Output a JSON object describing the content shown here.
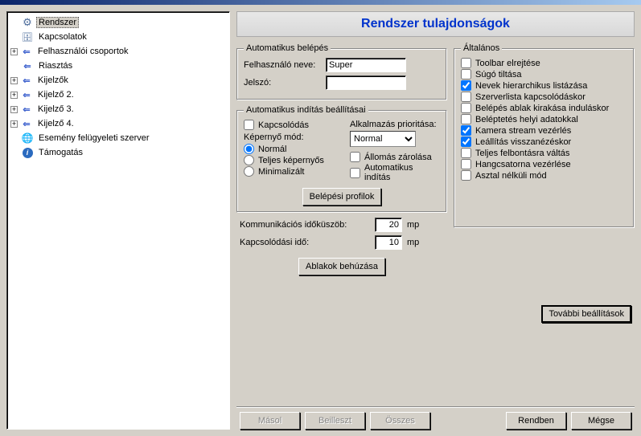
{
  "title": "Rendszer tulajdonságok",
  "tree": [
    {
      "label": "Rendszer",
      "icon": "gear",
      "selected": true,
      "expandable": false,
      "indent": 1
    },
    {
      "label": "Kapcsolatok",
      "icon": "db",
      "expandable": false,
      "indent": 1
    },
    {
      "label": "Felhasználói csoportok",
      "icon": "arrow",
      "expandable": true,
      "indent": 0
    },
    {
      "label": "Riasztás",
      "icon": "arrow",
      "expandable": false,
      "indent": 1
    },
    {
      "label": "Kijelzők",
      "icon": "arrow",
      "expandable": true,
      "indent": 0
    },
    {
      "label": "Kijelző 2.",
      "icon": "arrow",
      "expandable": true,
      "indent": 0
    },
    {
      "label": "Kijelző 3.",
      "icon": "arrow",
      "expandable": true,
      "indent": 0
    },
    {
      "label": "Kijelző 4.",
      "icon": "arrow",
      "expandable": true,
      "indent": 0
    },
    {
      "label": "Esemény felügyeleti szerver",
      "icon": "globe",
      "expandable": false,
      "indent": 1
    },
    {
      "label": "Támogatás",
      "icon": "info",
      "expandable": false,
      "indent": 1
    }
  ],
  "auto_login": {
    "legend": "Automatikus belépés",
    "user_label": "Felhasználó neve:",
    "user_value": "Super",
    "pass_label": "Jelszó:",
    "pass_value": ""
  },
  "auto_start": {
    "legend": "Automatikus indítás beállításai",
    "connect": "Kapcsolódás",
    "screen_mode_label": "Képernyő mód:",
    "radios": [
      "Normál",
      "Teljes képernyős",
      "Minimalizált"
    ],
    "radio_selected": 0,
    "priority_label": "Alkalmazás prioritása:",
    "priority_value": "Normal",
    "lock": "Állomás zárolása",
    "autostart": "Automatikus indítás",
    "profiles_btn": "Belépési profilok"
  },
  "comm": {
    "timeout_label": "Kommunikációs időküszöb:",
    "timeout_value": "20",
    "connect_label": "Kapcsolódási idő:",
    "connect_value": "10",
    "unit": "mp",
    "windows_btn": "Ablakok behúzása"
  },
  "general": {
    "legend": "Általános",
    "items": [
      {
        "label": "Toolbar elrejtése",
        "checked": false
      },
      {
        "label": "Súgó tiltása",
        "checked": false
      },
      {
        "label": "Nevek hierarchikus listázása",
        "checked": true
      },
      {
        "label": "Szerverlista kapcsolódáskor",
        "checked": false
      },
      {
        "label": "Belépés ablak kirakása induláskor",
        "checked": false
      },
      {
        "label": "Beléptetés helyi adatokkal",
        "checked": false
      },
      {
        "label": "Kamera stream vezérlés",
        "checked": true
      },
      {
        "label": "Leállítás visszanézéskor",
        "checked": true
      },
      {
        "label": "Teljes felbontásra váltás",
        "checked": false
      },
      {
        "label": "Hangcsatorna vezérlése",
        "checked": false
      },
      {
        "label": "Asztal nélküli mód",
        "checked": false
      }
    ],
    "more_btn": "További beállítások"
  },
  "buttons": {
    "copy": "Másol",
    "paste": "Beilleszt",
    "all": "Összes",
    "ok": "Rendben",
    "cancel": "Mégse"
  }
}
